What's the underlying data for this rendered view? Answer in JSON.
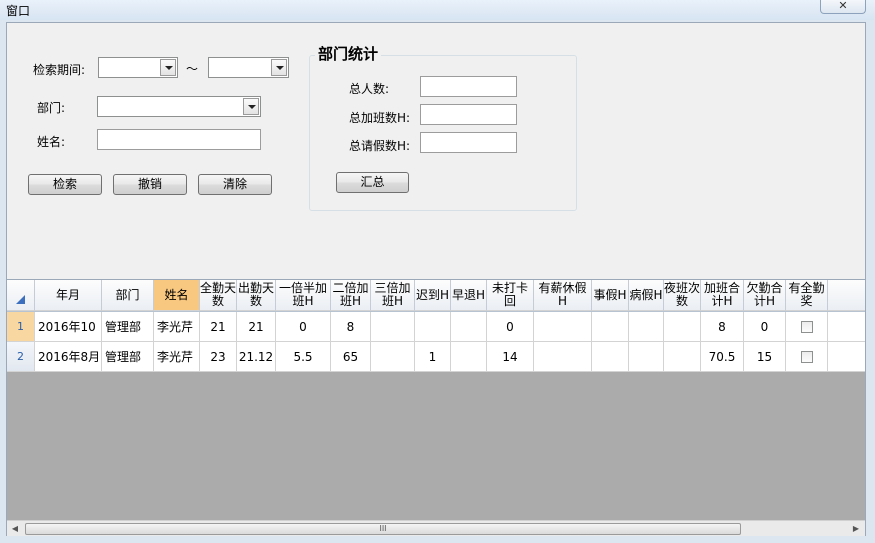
{
  "window": {
    "title": "窗口",
    "close_glyph": "✕"
  },
  "search": {
    "period_label": "检索期间:",
    "tilde": "～",
    "dept_label": "部门:",
    "name_label": "姓名:",
    "start_value": "",
    "end_value": "",
    "dept_value": "",
    "name_value": "",
    "buttons": {
      "search": "检索",
      "undo": "撤销",
      "clear": "清除"
    }
  },
  "stats": {
    "title": "部门统计",
    "total_people_label": "总人数:",
    "total_overtime_label": "总加班数H:",
    "total_leave_label": "总请假数H:",
    "total_people_value": "",
    "total_overtime_value": "",
    "total_leave_value": "",
    "summary_button": "汇总"
  },
  "table": {
    "columns": [
      "年月",
      "部门",
      "姓名",
      "全勤天数",
      "出勤天数",
      "一倍半加班H",
      "二倍加班H",
      "三倍加班H",
      "迟到H",
      "早退H",
      "未打卡回",
      "有薪休假H",
      "事假H",
      "病假H",
      "夜班次数",
      "加班合计H",
      "欠勤合计H",
      "有全勤奖"
    ],
    "rows": [
      {
        "num": "1",
        "cells": [
          "2016年10",
          "管理部",
          "李光芹",
          "21",
          "21",
          "0",
          "8",
          "",
          "",
          "",
          "0",
          "",
          "",
          "",
          "",
          "8",
          "0"
        ],
        "checked": false
      },
      {
        "num": "2",
        "cells": [
          "2016年8月",
          "管理部",
          "李光芹",
          "23",
          "21.12",
          "5.5",
          "65",
          "",
          "1",
          "",
          "14",
          "",
          "",
          "",
          "",
          "70.5",
          "15"
        ],
        "checked": false
      }
    ]
  },
  "scrollbar": {
    "left_arrow": "◀",
    "right_arrow": "▶",
    "grip": "III"
  },
  "icons": {
    "close": "close-icon",
    "dropdown": "chevron-down-icon",
    "corner": "select-all-icon"
  },
  "colors": {
    "selected_header": "#f8c880",
    "active_row_header": "#f8d8a0",
    "grid_empty": "#ababab"
  }
}
